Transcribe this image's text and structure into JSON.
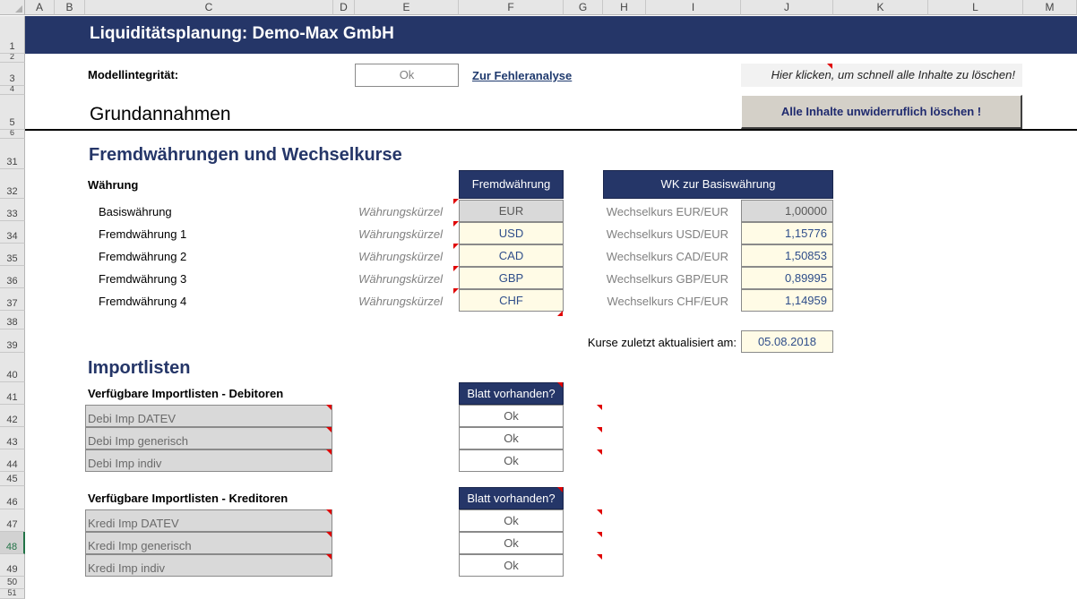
{
  "columns": [
    "A",
    "B",
    "C",
    "D",
    "E",
    "F",
    "G",
    "H",
    "I",
    "J",
    "K",
    "L",
    "M"
  ],
  "rows": [
    "1",
    "2",
    "3",
    "4",
    "5",
    "6",
    "31",
    "32",
    "33",
    "34",
    "35",
    "36",
    "37",
    "38",
    "39",
    "40",
    "41",
    "42",
    "43",
    "44",
    "45",
    "46",
    "47",
    "48",
    "49",
    "50",
    "51"
  ],
  "title": "Liquiditätsplanung: Demo-Max GmbH",
  "integrity": {
    "label": "Modellintegrität:",
    "value": "Ok",
    "link": "Zur Fehleranalyse"
  },
  "clear": {
    "hint": "Hier klicken, um schnell alle Inhalte zu löschen!",
    "button": "Alle Inhalte unwiderruflich löschen !"
  },
  "grundannahmen": "Grundannahmen",
  "currency": {
    "section": "Fremdwährungen und Wechselkurse",
    "label": "Währung",
    "col_header": "Fremdwährung",
    "rate_header": "WK zur Basiswährung",
    "rows": [
      {
        "name": "Basiswährung",
        "hint": "Währungskürzel",
        "code": "EUR",
        "rate_label": "Wechselkurs EUR/EUR",
        "rate": "1,00000"
      },
      {
        "name": "Fremdwährung 1",
        "hint": "Währungskürzel",
        "code": "USD",
        "rate_label": "Wechselkurs USD/EUR",
        "rate": "1,15776"
      },
      {
        "name": "Fremdwährung 2",
        "hint": "Währungskürzel",
        "code": "CAD",
        "rate_label": "Wechselkurs CAD/EUR",
        "rate": "1,50853"
      },
      {
        "name": "Fremdwährung 3",
        "hint": "Währungskürzel",
        "code": "GBP",
        "rate_label": "Wechselkurs GBP/EUR",
        "rate": "0,89995"
      },
      {
        "name": "Fremdwährung 4",
        "hint": "Währungskürzel",
        "code": "CHF",
        "rate_label": "Wechselkurs CHF/EUR",
        "rate": "1,14959"
      }
    ],
    "updated_label": "Kurse zuletzt aktualisiert am:",
    "updated_value": "05.08.2018"
  },
  "imports": {
    "section": "Importlisten",
    "debitoren": {
      "label": "Verfügbare Importlisten - Debitoren",
      "header": "Blatt vorhanden?",
      "items": [
        {
          "name": "Debi Imp DATEV",
          "status": "Ok"
        },
        {
          "name": "Debi Imp generisch",
          "status": "Ok"
        },
        {
          "name": "Debi Imp indiv",
          "status": "Ok"
        }
      ]
    },
    "kreditoren": {
      "label": "Verfügbare Importlisten - Kreditoren",
      "header": "Blatt vorhanden?",
      "items": [
        {
          "name": "Kredi Imp DATEV",
          "status": "Ok"
        },
        {
          "name": "Kredi Imp generisch",
          "status": "Ok"
        },
        {
          "name": "Kredi Imp indiv",
          "status": "Ok"
        }
      ]
    }
  }
}
